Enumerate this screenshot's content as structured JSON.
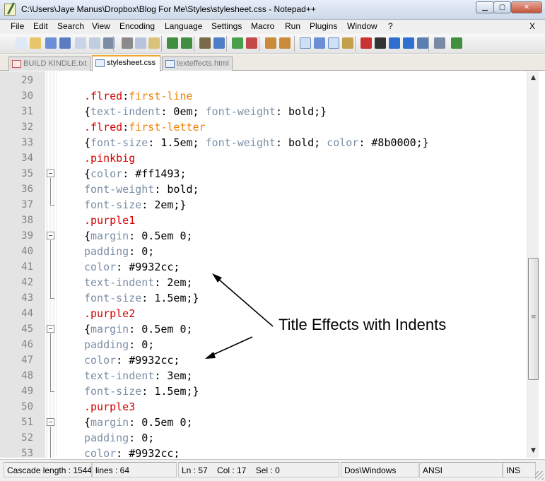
{
  "window": {
    "title": "C:\\Users\\Jaye Manus\\Dropbox\\Blog For Me\\Styles\\stylesheet.css - Notepad++",
    "min_glyph": "▁",
    "max_glyph": "▢",
    "close_glyph": "✕"
  },
  "menu": {
    "items": [
      "File",
      "Edit",
      "Search",
      "View",
      "Encoding",
      "Language",
      "Settings",
      "Macro",
      "Run",
      "Plugins",
      "Window",
      "?"
    ],
    "close_label": "X"
  },
  "toolbar": {
    "icons": [
      "new-file-icon",
      "open-file-icon",
      "save-icon",
      "save-all-icon",
      "close-file-icon",
      "close-all-icon",
      "print-icon",
      "cut-icon",
      "copy-icon",
      "paste-icon",
      "undo-icon",
      "redo-icon",
      "find-icon",
      "replace-icon",
      "zoom-in-icon",
      "zoom-out-icon",
      "sync-vertical-icon",
      "sync-horizontal-icon",
      "word-wrap-icon",
      "show-all-characters-icon",
      "indent-guide-icon",
      "user-defined-language-icon",
      "record-macro-icon",
      "stop-recording-icon",
      "playback-macro-icon",
      "run-macro-multiple-icon",
      "save-macro-icon",
      "document-map-icon",
      "spell-check-icon"
    ]
  },
  "tabs": [
    {
      "label": "BUILD KINDLE.txt",
      "active": false,
      "unsaved": true
    },
    {
      "label": "stylesheet.css",
      "active": true,
      "unsaved": false
    },
    {
      "label": "texteffects.html",
      "active": false,
      "unsaved": false
    }
  ],
  "editor": {
    "lines": [
      {
        "n": "29",
        "tokens": []
      },
      {
        "n": "30",
        "tokens": [
          [
            ".flred",
            "sel"
          ],
          [
            ":",
            "txt"
          ],
          [
            "first-line",
            "pseudo"
          ]
        ]
      },
      {
        "n": "31",
        "tokens": [
          [
            "{",
            "txt"
          ],
          [
            "text-indent",
            "prop"
          ],
          [
            ": 0em; ",
            "txt"
          ],
          [
            "font-weight",
            "prop"
          ],
          [
            ": bold;}",
            "txt"
          ]
        ]
      },
      {
        "n": "32",
        "tokens": [
          [
            ".flred",
            "sel"
          ],
          [
            ":",
            "txt"
          ],
          [
            "first-letter",
            "pseudo"
          ]
        ]
      },
      {
        "n": "33",
        "tokens": [
          [
            "{",
            "txt"
          ],
          [
            "font-size",
            "prop"
          ],
          [
            ": 1.5em; ",
            "txt"
          ],
          [
            "font-weight",
            "prop"
          ],
          [
            ": bold; ",
            "txt"
          ],
          [
            "color",
            "prop"
          ],
          [
            ": #8b0000;}",
            "txt"
          ]
        ]
      },
      {
        "n": "34",
        "tokens": [
          [
            ".pinkbig",
            "sel"
          ]
        ]
      },
      {
        "n": "35",
        "tokens": [
          [
            "{",
            "txt"
          ],
          [
            "color",
            "prop"
          ],
          [
            ": #ff1493;",
            "txt"
          ]
        ]
      },
      {
        "n": "36",
        "tokens": [
          [
            "font-weight",
            "prop"
          ],
          [
            ": bold;",
            "txt"
          ]
        ]
      },
      {
        "n": "37",
        "tokens": [
          [
            "font-size",
            "prop"
          ],
          [
            ": 2em;}",
            "txt"
          ]
        ]
      },
      {
        "n": "38",
        "tokens": [
          [
            ".purple1",
            "sel"
          ]
        ]
      },
      {
        "n": "39",
        "tokens": [
          [
            "{",
            "txt"
          ],
          [
            "margin",
            "prop"
          ],
          [
            ": 0.5em 0;",
            "txt"
          ]
        ]
      },
      {
        "n": "40",
        "tokens": [
          [
            "padding",
            "prop"
          ],
          [
            ": 0;",
            "txt"
          ]
        ]
      },
      {
        "n": "41",
        "tokens": [
          [
            "color",
            "prop"
          ],
          [
            ": #9932cc;",
            "txt"
          ]
        ]
      },
      {
        "n": "42",
        "tokens": [
          [
            "text-indent",
            "prop"
          ],
          [
            ": 2em;",
            "txt"
          ]
        ]
      },
      {
        "n": "43",
        "tokens": [
          [
            "font-size",
            "prop"
          ],
          [
            ": 1.5em;}",
            "txt"
          ]
        ]
      },
      {
        "n": "44",
        "tokens": [
          [
            ".purple2",
            "sel"
          ]
        ]
      },
      {
        "n": "45",
        "tokens": [
          [
            "{",
            "txt"
          ],
          [
            "margin",
            "prop"
          ],
          [
            ": 0.5em 0;",
            "txt"
          ]
        ]
      },
      {
        "n": "46",
        "tokens": [
          [
            "padding",
            "prop"
          ],
          [
            ": 0;",
            "txt"
          ]
        ]
      },
      {
        "n": "47",
        "tokens": [
          [
            "color",
            "prop"
          ],
          [
            ": #9932cc;",
            "txt"
          ]
        ]
      },
      {
        "n": "48",
        "tokens": [
          [
            "text-indent",
            "prop"
          ],
          [
            ": 3em;",
            "txt"
          ]
        ]
      },
      {
        "n": "49",
        "tokens": [
          [
            "font-size",
            "prop"
          ],
          [
            ": 1.5em;}",
            "txt"
          ]
        ]
      },
      {
        "n": "50",
        "tokens": [
          [
            ".purple3",
            "sel"
          ]
        ]
      },
      {
        "n": "51",
        "tokens": [
          [
            "{",
            "txt"
          ],
          [
            "margin",
            "prop"
          ],
          [
            ": 0.5em 0;",
            "txt"
          ]
        ]
      },
      {
        "n": "52",
        "tokens": [
          [
            "padding",
            "prop"
          ],
          [
            ": 0;",
            "txt"
          ]
        ]
      },
      {
        "n": "53",
        "tokens": [
          [
            "color",
            "prop"
          ],
          [
            ": #9932cc;",
            "txt"
          ]
        ]
      }
    ],
    "fold_lines": [
      "35",
      "39",
      "45",
      "51"
    ]
  },
  "annotation": {
    "text": "Title Effects with Indents"
  },
  "scrollbar": {
    "up_glyph": "▲",
    "down_glyph": "▼",
    "grip_glyph": "≡"
  },
  "status": {
    "length": "Cascade length : 1544",
    "lines": "lines : 64",
    "ln": "Ln : 57",
    "col": "Col : 17",
    "sel": "Sel : 0",
    "eol": "Dos\\Windows",
    "encoding": "ANSI",
    "mode": "INS"
  },
  "colors": {
    "selector": "#d40000",
    "property": "#7b8fa6",
    "pseudo": "#f08000",
    "gutter": "#e4e4e4"
  }
}
